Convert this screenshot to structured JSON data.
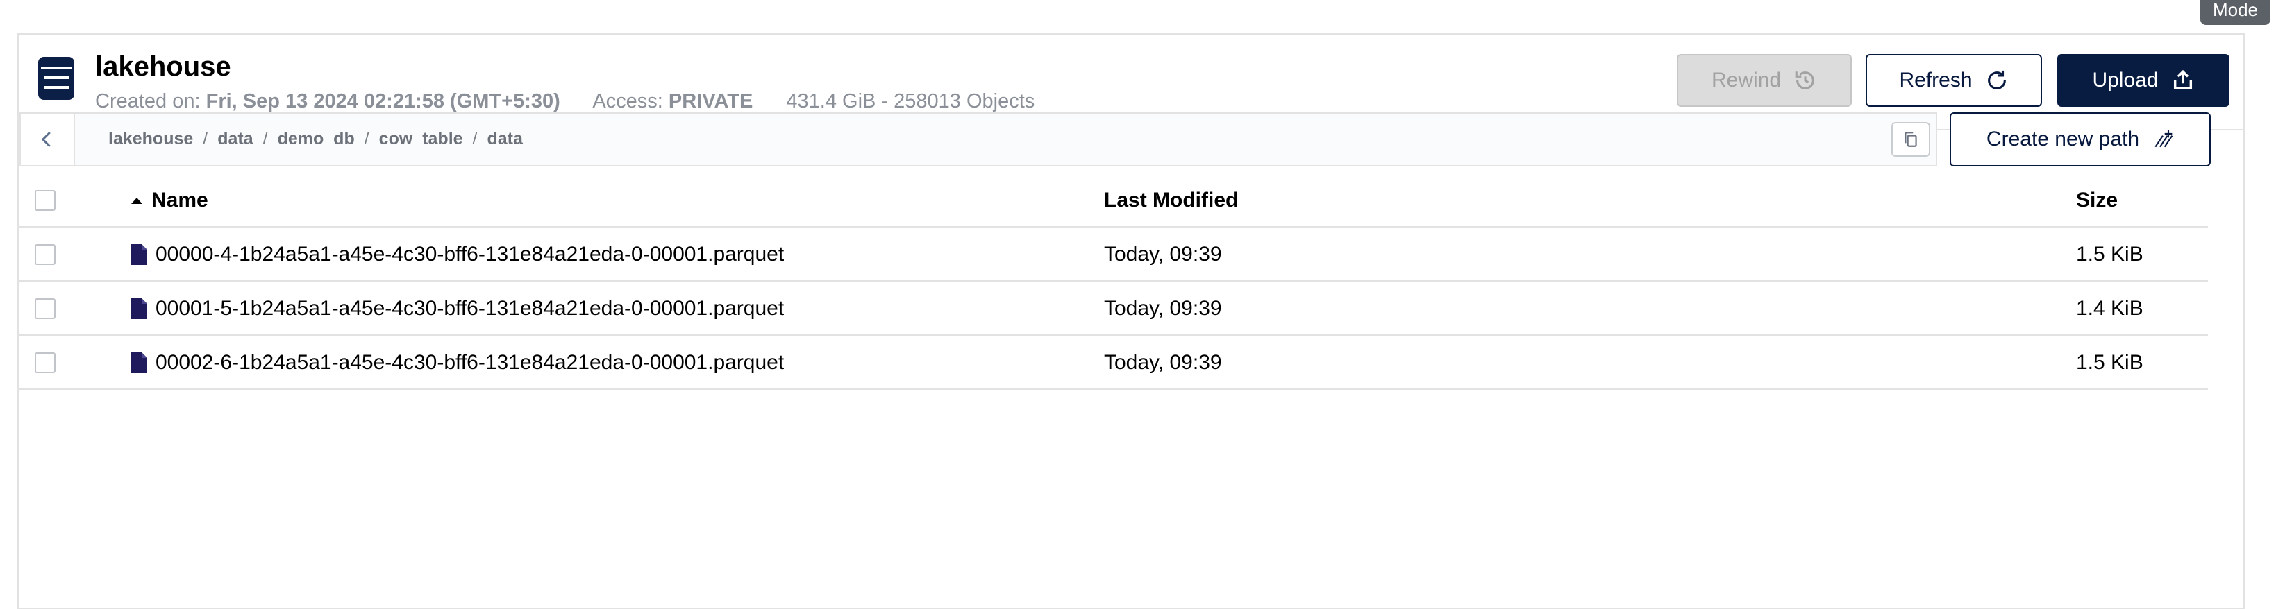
{
  "tooltip": "Mode",
  "bucket": {
    "name": "lakehouse",
    "created_label": "Created on:",
    "created_value": "Fri, Sep 13 2024 02:21:58 (GMT+5:30)",
    "access_label": "Access:",
    "access_value": "PRIVATE",
    "usage": "431.4 GiB - 258013 Objects"
  },
  "actions": {
    "rewind": "Rewind",
    "refresh": "Refresh",
    "upload": "Upload",
    "create_new_path": "Create new path"
  },
  "breadcrumb": [
    "lakehouse",
    "data",
    "demo_db",
    "cow_table",
    "data"
  ],
  "table": {
    "headers": {
      "name": "Name",
      "modified": "Last Modified",
      "size": "Size"
    },
    "rows": [
      {
        "name": "00000-4-1b24a5a1-a45e-4c30-bff6-131e84a21eda-0-00001.parquet",
        "modified": "Today, 09:39",
        "size": "1.5 KiB"
      },
      {
        "name": "00001-5-1b24a5a1-a45e-4c30-bff6-131e84a21eda-0-00001.parquet",
        "modified": "Today, 09:39",
        "size": "1.4 KiB"
      },
      {
        "name": "00002-6-1b24a5a1-a45e-4c30-bff6-131e84a21eda-0-00001.parquet",
        "modified": "Today, 09:39",
        "size": "1.5 KiB"
      }
    ]
  },
  "icons": {
    "bucket": "bucket-icon",
    "rewind": "history-icon",
    "refresh": "refresh-icon",
    "upload": "upload-icon",
    "back": "chevron-left-icon",
    "copy": "copy-icon",
    "new_path": "new-path-icon",
    "sort": "sort-asc-icon",
    "file": "file-icon"
  },
  "colors": {
    "primary": "#081c42",
    "file_icon": "#1e1a5c",
    "disabled": "#dcdcdc"
  }
}
